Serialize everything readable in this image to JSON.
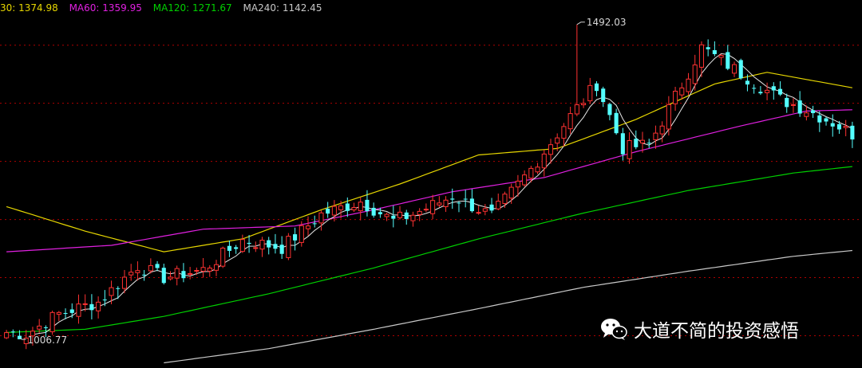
{
  "legend": {
    "ma30": "30: 1374.98",
    "ma60": "MA60: 1359.95",
    "ma120": "MA120: 1271.67",
    "ma240": "MA240: 1142.45"
  },
  "watermark": "大道不简的投资感悟",
  "colors": {
    "background": "#000000",
    "up": "#ff3232",
    "down": "#54ffff",
    "ma_short": "#e6e6e6",
    "ma30": "#e6d600",
    "ma60": "#e020e0",
    "ma120": "#00d000",
    "ma240": "#c8c8c8",
    "grid": "#b00000"
  },
  "chart_data": {
    "type": "candlestick",
    "ylim": [
      960,
      1530
    ],
    "grid": true,
    "gridlines": [
      1010,
      1100,
      1190,
      1280,
      1370,
      1460
    ],
    "annotations": {
      "high": "1492.03",
      "low": "1006.77"
    },
    "n_candles": 130,
    "high_value": 1492.03,
    "high_index": 87,
    "low_value": 1006.77,
    "low_index": 2,
    "anchors": [
      [
        0,
        1015
      ],
      [
        3,
        1012
      ],
      [
        8,
        1044
      ],
      [
        14,
        1062
      ],
      [
        20,
        1118
      ],
      [
        24,
        1100
      ],
      [
        30,
        1112
      ],
      [
        36,
        1158
      ],
      [
        42,
        1146
      ],
      [
        48,
        1198
      ],
      [
        54,
        1218
      ],
      [
        59,
        1188
      ],
      [
        62,
        1198
      ],
      [
        68,
        1226
      ],
      [
        74,
        1196
      ],
      [
        80,
        1268
      ],
      [
        86,
        1350
      ],
      [
        90,
        1400
      ],
      [
        94,
        1300
      ],
      [
        98,
        1306
      ],
      [
        102,
        1380
      ],
      [
        106,
        1456
      ],
      [
        112,
        1416
      ],
      [
        118,
        1376
      ],
      [
        122,
        1360
      ],
      [
        126,
        1340
      ],
      [
        129,
        1322
      ]
    ],
    "ma_lines": [
      {
        "name": "MA30",
        "value": 1374.98,
        "points": [
          [
            0,
            1210
          ],
          [
            12,
            1172
          ],
          [
            24,
            1140
          ],
          [
            36,
            1160
          ],
          [
            48,
            1205
          ],
          [
            60,
            1245
          ],
          [
            72,
            1290
          ],
          [
            84,
            1300
          ],
          [
            96,
            1345
          ],
          [
            108,
            1400
          ],
          [
            116,
            1418
          ],
          [
            129,
            1394
          ]
        ]
      },
      {
        "name": "MA60",
        "value": 1359.95,
        "points": [
          [
            0,
            1140
          ],
          [
            16,
            1150
          ],
          [
            30,
            1175
          ],
          [
            44,
            1180
          ],
          [
            56,
            1205
          ],
          [
            68,
            1233
          ],
          [
            82,
            1255
          ],
          [
            96,
            1295
          ],
          [
            112,
            1335
          ],
          [
            122,
            1358
          ],
          [
            129,
            1360
          ]
        ]
      },
      {
        "name": "MA120",
        "value": 1271.67,
        "points": [
          [
            0,
            1015
          ],
          [
            12,
            1020
          ],
          [
            24,
            1040
          ],
          [
            40,
            1075
          ],
          [
            56,
            1115
          ],
          [
            72,
            1160
          ],
          [
            88,
            1200
          ],
          [
            104,
            1235
          ],
          [
            120,
            1262
          ],
          [
            129,
            1272
          ]
        ]
      },
      {
        "name": "MA240",
        "value": 1142.45,
        "points": [
          [
            24,
            968
          ],
          [
            40,
            990
          ],
          [
            56,
            1020
          ],
          [
            72,
            1052
          ],
          [
            88,
            1085
          ],
          [
            104,
            1110
          ],
          [
            120,
            1133
          ],
          [
            129,
            1142
          ]
        ]
      }
    ]
  }
}
